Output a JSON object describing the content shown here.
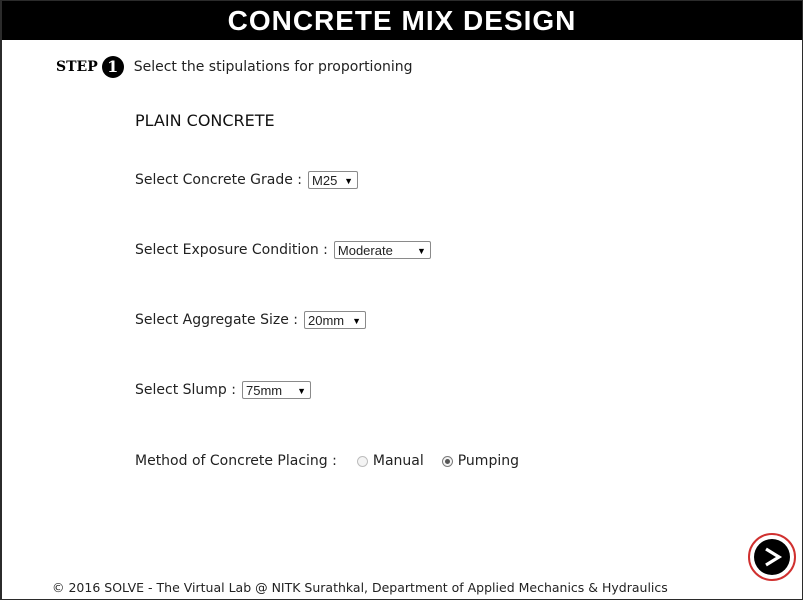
{
  "header": {
    "title": "CONCRETE MIX DESIGN"
  },
  "step": {
    "label": "STEP",
    "number": "1",
    "description": "Select the stipulations for proportioning"
  },
  "section": {
    "title": "PLAIN CONCRETE"
  },
  "fields": {
    "grade": {
      "label": "Select Concrete Grade :",
      "value": "M25"
    },
    "exposure": {
      "label": "Select Exposure Condition :",
      "value": "Moderate"
    },
    "aggregate": {
      "label": "Select Aggregate Size :",
      "value": "20mm"
    },
    "slump": {
      "label": "Select Slump :",
      "value": "75mm"
    },
    "placing": {
      "label": "Method of Concrete Placing :",
      "options": [
        "Manual",
        "Pumping"
      ],
      "selected": "Pumping"
    }
  },
  "footer": {
    "text": "© 2016 SOLVE - The Virtual Lab @ NITK Surathkal, Department of Applied Mechanics & Hydraulics"
  },
  "icons": {
    "next": "next-arrow-icon",
    "dropdown": "chevron-down-icon"
  },
  "colors": {
    "header_bg": "#000000",
    "next_ring": "#d0302f"
  }
}
